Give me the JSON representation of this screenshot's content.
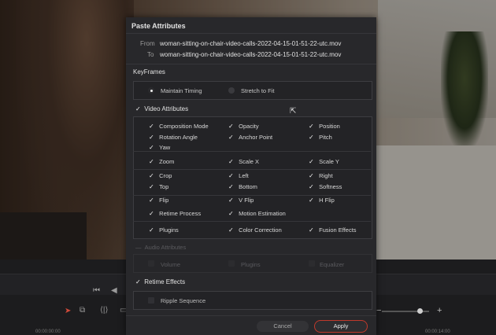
{
  "dialog": {
    "title": "Paste Attributes",
    "from_label": "From",
    "from_value": "woman-sitting-on-chair-video-calls-2022-04-15-01-51-22-utc.mov",
    "to_label": "To",
    "to_value": "woman-sitting-on-chair-video-calls-2022-04-15-01-51-22-utc.mov",
    "keyframes_label": "KeyFrames",
    "maintain_timing": "Maintain Timing",
    "stretch_to_fit": "Stretch to Fit",
    "video_attributes": "Video Attributes",
    "video": {
      "composition_mode": "Composition Mode",
      "opacity": "Opacity",
      "position": "Position",
      "rotation_angle": "Rotation Angle",
      "anchor_point": "Anchor Point",
      "pitch": "Pitch",
      "yaw": "Yaw",
      "zoom": "Zoom",
      "scale_x": "Scale X",
      "scale_y": "Scale Y",
      "crop": "Crop",
      "left": "Left",
      "right": "Right",
      "top": "Top",
      "bottom": "Bottom",
      "softness": "Softness",
      "flip": "Flip",
      "v_flip": "V Flip",
      "h_flip": "H Flip",
      "retime_process": "Retime Process",
      "motion_estimation": "Motion Estimation",
      "plugins": "Plugins",
      "color_correction": "Color Correction",
      "fusion_effects": "Fusion Effects"
    },
    "audio_attributes": "Audio Attributes",
    "audio": {
      "volume": "Volume",
      "plugins": "Plugins",
      "equalizer": "Equalizer"
    },
    "retime_effects": "Retime Effects",
    "ripple_sequence": "Ripple Sequence",
    "cancel": "Cancel",
    "apply": "Apply"
  },
  "checkmark": "✓",
  "timeline": {
    "tc_left": "00:00:00:00",
    "tc_right": "00:00:14:00"
  },
  "accent_color": "#c0392b"
}
